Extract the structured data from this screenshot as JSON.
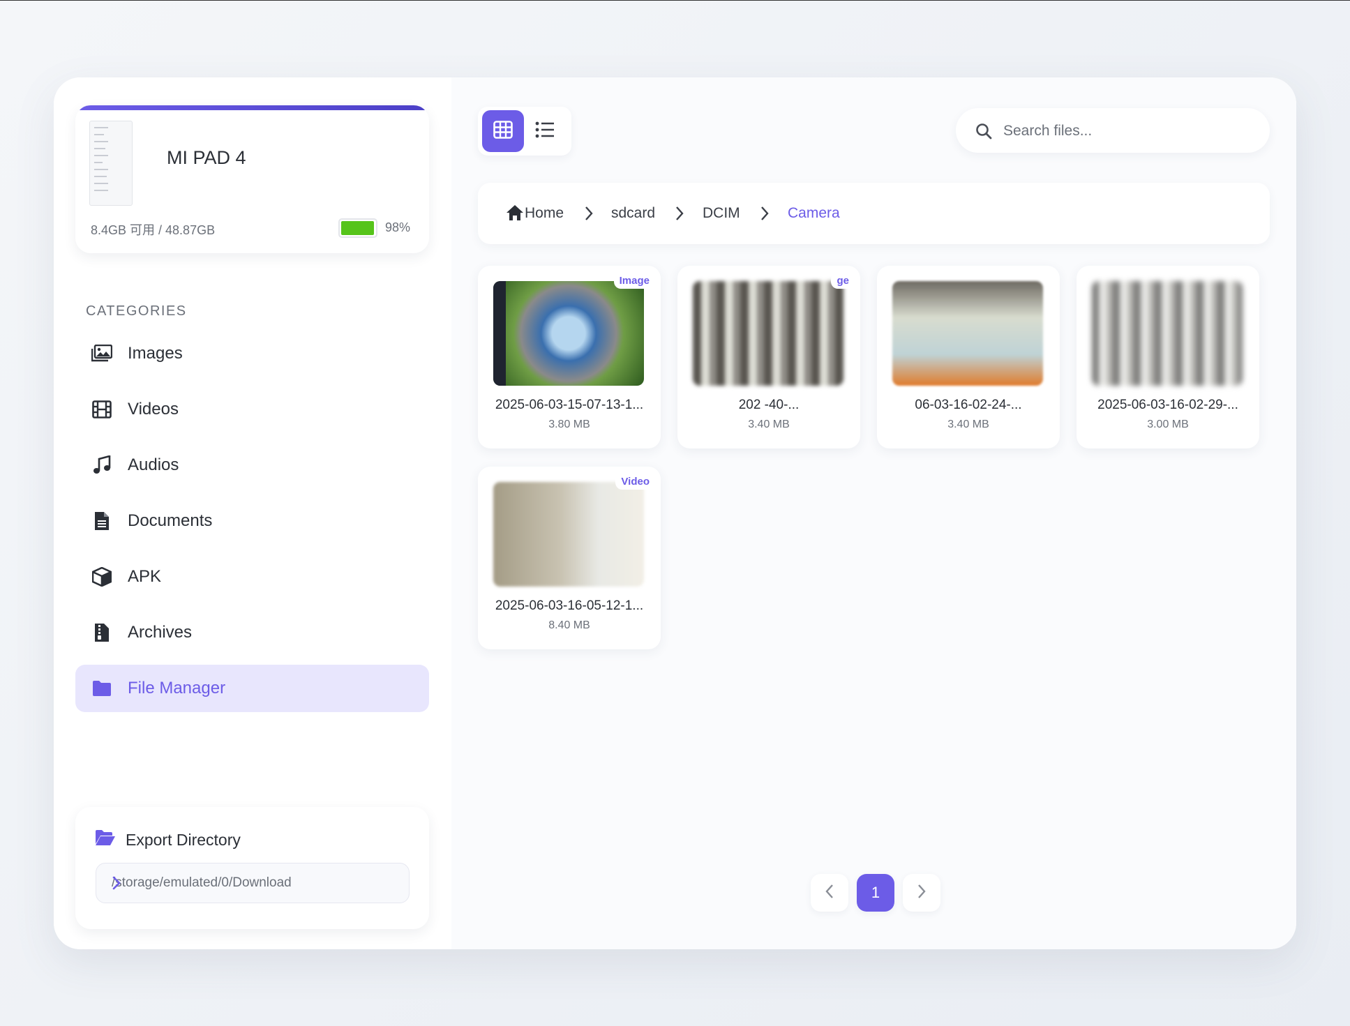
{
  "device": {
    "name": "MI PAD 4",
    "storage": "8.4GB 可用 / 48.87GB",
    "battery_percent": "98%",
    "battery_level": 0.98
  },
  "sidebar": {
    "section_title": "CATEGORIES",
    "items": [
      {
        "label": "Images",
        "icon": "images-icon"
      },
      {
        "label": "Videos",
        "icon": "film-icon"
      },
      {
        "label": "Audios",
        "icon": "music-icon"
      },
      {
        "label": "Documents",
        "icon": "document-icon"
      },
      {
        "label": "APK",
        "icon": "box-icon"
      },
      {
        "label": "Archives",
        "icon": "archive-icon"
      },
      {
        "label": "File Manager",
        "icon": "folder-icon",
        "active": true
      }
    ]
  },
  "export": {
    "title": "Export Directory",
    "path": "/storage/emulated/0/Download"
  },
  "search": {
    "placeholder": "Search files..."
  },
  "breadcrumb": [
    "Home",
    "sdcard",
    "DCIM",
    "Camera"
  ],
  "files": [
    {
      "name": "2025-06-03-15-07-13-1...",
      "size": "3.80 MB",
      "badge": "Image"
    },
    {
      "name": "202 -40-...",
      "size": "3.40 MB",
      "badge": "ge"
    },
    {
      "name": "06-03-16-02-24-...",
      "size": "3.40 MB",
      "badge": ""
    },
    {
      "name": "2025-06-03-16-02-29-...",
      "size": "3.00 MB",
      "badge": ""
    },
    {
      "name": "2025-06-03-16-05-12-1...",
      "size": "8.40 MB",
      "badge": "Video"
    }
  ],
  "pagination": {
    "current": "1"
  },
  "colors": {
    "accent": "#6c5ce7",
    "battery": "#56c41a",
    "active_bg": "#e8e6fd"
  }
}
